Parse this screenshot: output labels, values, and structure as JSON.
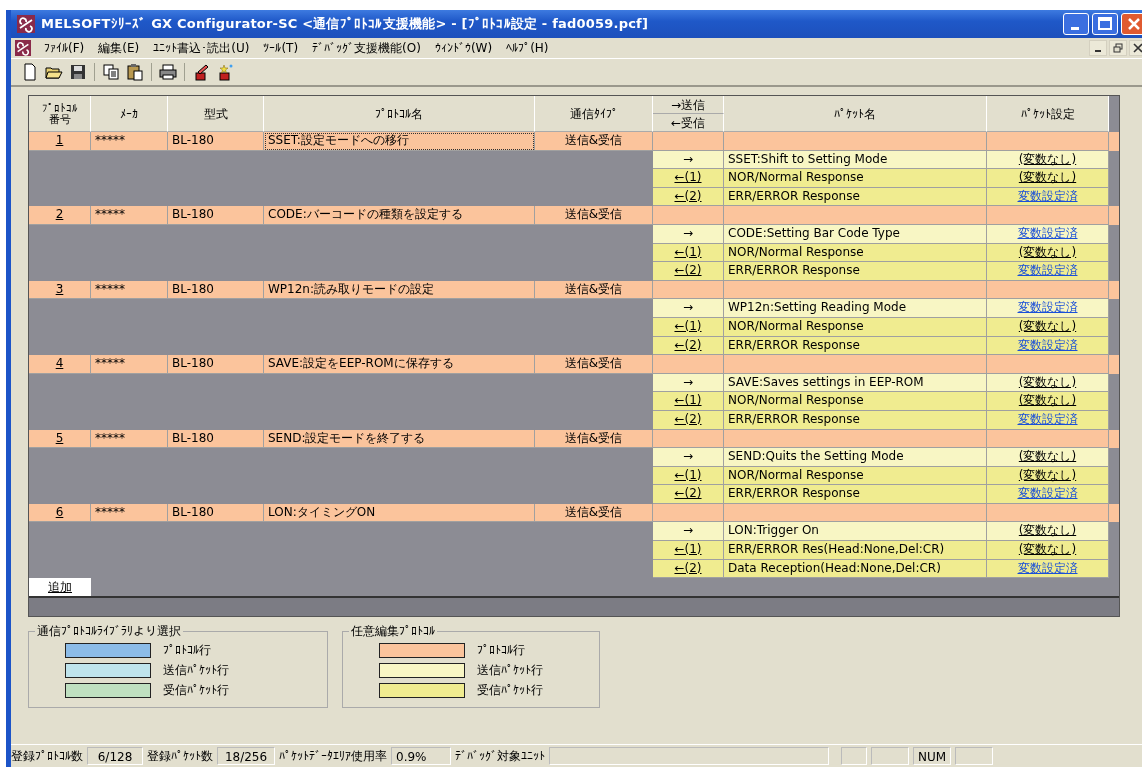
{
  "window": {
    "title": "MELSOFTｼﾘｰｽﾞ GX Configurator-SC <通信ﾌﾟﾛﾄｺﾙ支援機能> - [ﾌﾟﾛﾄｺﾙ設定 - fad0059.pcf]"
  },
  "menu": [
    {
      "label": "ﾌｧｲﾙ(F)"
    },
    {
      "label": "編集(E)"
    },
    {
      "label": "ﾕﾆｯﾄ書込･読出(U)"
    },
    {
      "label": "ﾂｰﾙ(T)"
    },
    {
      "label": "ﾃﾞﾊﾞｯｸﾞ支援機能(O)"
    },
    {
      "label": "ｳｨﾝﾄﾞｳ(W)"
    },
    {
      "label": "ﾍﾙﾌﾟ(H)"
    }
  ],
  "toolbar": [
    {
      "kind": "new"
    },
    {
      "kind": "open"
    },
    {
      "kind": "save"
    },
    {
      "kind": "sep"
    },
    {
      "kind": "copy"
    },
    {
      "kind": "paste"
    },
    {
      "kind": "sep"
    },
    {
      "kind": "print"
    },
    {
      "kind": "sep"
    },
    {
      "kind": "edit"
    },
    {
      "kind": "wizard"
    }
  ],
  "table": {
    "columns": [
      "ﾌﾟﾛﾄｺﾙ番号",
      "ﾒｰｶ",
      "型式",
      "ﾌﾟﾛﾄｺﾙ名",
      "通信ﾀｲﾌﾟ",
      "→送信",
      "←受信",
      "ﾊﾟｹｯﾄ名",
      "ﾊﾟｹｯﾄ設定"
    ],
    "protocols": [
      {
        "number": "1",
        "maker": "*****",
        "model": "BL-180",
        "name": "SSET:設定モードへの移行",
        "type": "送信&受信",
        "focused": true,
        "packets": [
          {
            "kind": "send",
            "direction": "→",
            "name": "SSET:Shift to Setting Mode",
            "setting": "(変数なし)",
            "configured": false
          },
          {
            "kind": "receive",
            "direction": "←(1)",
            "name": "NOR/Normal Response",
            "setting": "(変数なし)",
            "configured": false
          },
          {
            "kind": "receive",
            "direction": "←(2)",
            "name": "ERR/ERROR Response",
            "setting": "変数設定済",
            "configured": true
          }
        ]
      },
      {
        "number": "2",
        "maker": "*****",
        "model": "BL-180",
        "name": "CODE:バーコードの種類を設定する",
        "type": "送信&受信",
        "focused": false,
        "packets": [
          {
            "kind": "send",
            "direction": "→",
            "name": "CODE:Setting Bar Code Type",
            "setting": "変数設定済",
            "configured": true
          },
          {
            "kind": "receive",
            "direction": "←(1)",
            "name": "NOR/Normal Response",
            "setting": "(変数なし)",
            "configured": false
          },
          {
            "kind": "receive",
            "direction": "←(2)",
            "name": "ERR/ERROR Response",
            "setting": "変数設定済",
            "configured": true
          }
        ]
      },
      {
        "number": "3",
        "maker": "*****",
        "model": "BL-180",
        "name": "WP12n:読み取りモードの設定",
        "type": "送信&受信",
        "focused": false,
        "packets": [
          {
            "kind": "send",
            "direction": "→",
            "name": "WP12n:Setting Reading Mode",
            "setting": "変数設定済",
            "configured": true
          },
          {
            "kind": "receive",
            "direction": "←(1)",
            "name": "NOR/Normal Response",
            "setting": "(変数なし)",
            "configured": false
          },
          {
            "kind": "receive",
            "direction": "←(2)",
            "name": "ERR/ERROR Response",
            "setting": "変数設定済",
            "configured": true
          }
        ]
      },
      {
        "number": "4",
        "maker": "*****",
        "model": "BL-180",
        "name": "SAVE:設定をEEP-ROMに保存する",
        "type": "送信&受信",
        "focused": false,
        "packets": [
          {
            "kind": "send",
            "direction": "→",
            "name": "SAVE:Saves settings in EEP-ROM",
            "setting": "(変数なし)",
            "configured": false
          },
          {
            "kind": "receive",
            "direction": "←(1)",
            "name": "NOR/Normal Response",
            "setting": "(変数なし)",
            "configured": false
          },
          {
            "kind": "receive",
            "direction": "←(2)",
            "name": "ERR/ERROR Response",
            "setting": "変数設定済",
            "configured": true
          }
        ]
      },
      {
        "number": "5",
        "maker": "*****",
        "model": "BL-180",
        "name": "SEND:設定モードを終了する",
        "type": "送信&受信",
        "focused": false,
        "packets": [
          {
            "kind": "send",
            "direction": "→",
            "name": "SEND:Quits the Setting Mode",
            "setting": "(変数なし)",
            "configured": false
          },
          {
            "kind": "receive",
            "direction": "←(1)",
            "name": "NOR/Normal Response",
            "setting": "(変数なし)",
            "configured": false
          },
          {
            "kind": "receive",
            "direction": "←(2)",
            "name": "ERR/ERROR Response",
            "setting": "変数設定済",
            "configured": true
          }
        ]
      },
      {
        "number": "6",
        "maker": "*****",
        "model": "BL-180",
        "name": "LON:タイミングON",
        "type": "送信&受信",
        "focused": false,
        "packets": [
          {
            "kind": "send",
            "direction": "→",
            "name": "LON:Trigger On",
            "setting": "(変数なし)",
            "configured": false
          },
          {
            "kind": "receive",
            "direction": "←(1)",
            "name": "ERR/ERROR Res(Head:None,Del:CR)",
            "setting": "(変数なし)",
            "configured": false
          },
          {
            "kind": "receive",
            "direction": "←(2)",
            "name": "Data Reception(Head:None,Del:CR)",
            "setting": "変数設定済",
            "configured": true
          }
        ]
      }
    ],
    "add_button": "追加"
  },
  "legend": [
    {
      "title": "通信ﾌﾟﾛﾄｺﾙﾗｲﾌﾞﾗﾘより選択",
      "items": [
        {
          "label": "ﾌﾟﾛﾄｺﾙ行",
          "color": "#8cbce8"
        },
        {
          "label": "送信ﾊﾟｹｯﾄ行",
          "color": "#bfe4ec"
        },
        {
          "label": "受信ﾊﾟｹｯﾄ行",
          "color": "#bfe0c0"
        }
      ]
    },
    {
      "title": "任意編集ﾌﾟﾛﾄｺﾙ",
      "items": [
        {
          "label": "ﾌﾟﾛﾄｺﾙ行",
          "color": "#fbc49c"
        },
        {
          "label": "送信ﾊﾟｹｯﾄ行",
          "color": "#f8f6c4"
        },
        {
          "label": "受信ﾊﾟｹｯﾄ行",
          "color": "#f0ec90"
        }
      ]
    }
  ],
  "status_bar": [
    {
      "label": "登録ﾌﾟﾛﾄｺﾙ数",
      "value": "6/128"
    },
    {
      "label": "登録ﾊﾟｹｯﾄ数",
      "value": "18/256"
    },
    {
      "label": "ﾊﾟｹｯﾄﾃﾞｰﾀｴﾘｱ使用率",
      "value": "0.9%"
    },
    {
      "label": "ﾃﾞﾊﾞｯｸﾞ対象ﾕﾆｯﾄ"
    }
  ],
  "indicators": [
    "NUM"
  ]
}
